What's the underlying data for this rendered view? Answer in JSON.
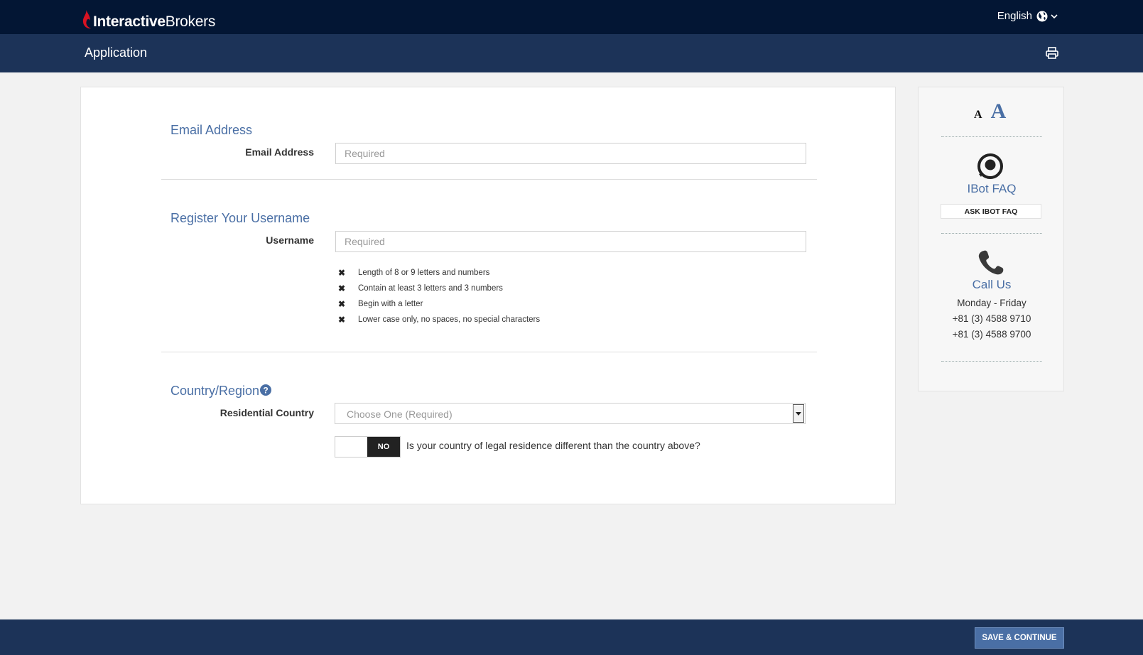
{
  "header": {
    "logo_bold": "Interactive",
    "logo_regular": "Brokers",
    "language": "English"
  },
  "subheader": {
    "title": "Application"
  },
  "form": {
    "email": {
      "section_title": "Email Address",
      "label": "Email Address",
      "placeholder": "Required",
      "value": ""
    },
    "username": {
      "section_title": "Register Your Username",
      "label": "Username",
      "placeholder": "Required",
      "value": "",
      "rules": [
        "Length of 8 or 9 letters and numbers",
        "Contain at least 3 letters and 3 numbers",
        "Begin with a letter",
        "Lower case only, no spaces, no special characters"
      ]
    },
    "country": {
      "section_title": "Country/Region",
      "label": "Residential Country",
      "selected": "Choose One (Required)",
      "toggle_state": "NO",
      "toggle_question": "Is your country of legal residence different than the country above?"
    }
  },
  "sidebar": {
    "font_small": "A",
    "font_large": "A",
    "ibot_title": "IBot FAQ",
    "ibot_button": "ASK IBOT FAQ",
    "call_title": "Call Us",
    "hours": "Monday - Friday",
    "phones": [
      "+81 (3) 4588 9710",
      "+81 (3) 4588 9700"
    ]
  },
  "footer": {
    "save_label": "SAVE & CONTINUE"
  },
  "colors": {
    "topbar": "#031634",
    "subbar": "#1c3358",
    "accent": "#4a6fa5",
    "logo_red": "#d81222"
  }
}
